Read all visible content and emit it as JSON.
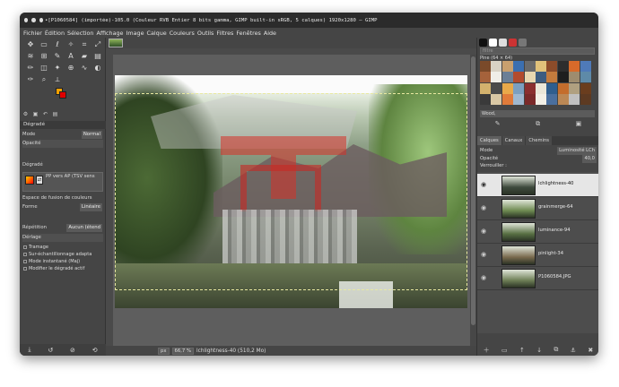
{
  "window": {
    "title": "•[P1060584] (importée)-105.0 (Couleur RVB Entier 8 bits gamma, GIMP built-in sRGB, 5 calques) 1920x1280 – GIMP"
  },
  "menu": [
    "Fichier",
    "Édition",
    "Sélection",
    "Affichage",
    "Image",
    "Calque",
    "Couleurs",
    "Outils",
    "Filtres",
    "Fenêtres",
    "Aide"
  ],
  "toolbox": {
    "tool_icons": [
      "move-icon",
      "rect-select-icon",
      "lasso-icon",
      "fuzzy-select-icon",
      "crop-icon",
      "unified-transform-icon",
      "warp-icon",
      "cage-icon",
      "paths-icon",
      "text-icon",
      "bucket-icon",
      "gradient-icon",
      "paintbrush-icon",
      "eraser-icon",
      "airbrush-icon",
      "clone-icon",
      "smudge-icon",
      "dodge-icon",
      "color-picker-icon",
      "zoom-icon",
      "measure-icon"
    ],
    "tool_glyphs": [
      "✥",
      "▭",
      "ℓ",
      "✧",
      "⌗",
      "⤢",
      "≋",
      "⊞",
      "✎",
      "A",
      "▰",
      "▤",
      "✏",
      "◫",
      "✦",
      "⊕",
      "∿",
      "◐",
      "✑",
      "⌕",
      "⟂"
    ],
    "tool_options_title": "Dégradé",
    "mode_label": "Mode",
    "mode_value": "Normal",
    "opacity_label": "Opacité",
    "gradient_label": "Dégradé",
    "gradient_name": "PP vers AP (TSV sens",
    "blend_space_label": "Espace de fusion de couleurs",
    "shape_label": "Forme",
    "shape_value": "Linéaire",
    "repeat_label": "Répétition",
    "repeat_value": "Aucun (étend",
    "dither_label": "Dérlage",
    "adaptive_label": "Tramage",
    "supersample_label": "Sur-échantillonnage adapta",
    "instant_label": "Mode instantané (Maj)",
    "modify_label": "Modifier le dégradé actif"
  },
  "canvas": {
    "unit": "px",
    "zoom": "66,7 %",
    "layer_status": "lchlightness-40 (510,2 Mo)"
  },
  "dock": {
    "filter_placeholder": "filtre",
    "pattern_label": "Pine (64 × 64)",
    "pattern_name": "Wood,",
    "tabs": [
      "Calques",
      "Canaux",
      "Chemins"
    ],
    "mode_label": "Mode",
    "mode_value": "Luminosité LCh",
    "opacity_label": "Opacité",
    "opacity_value": "40,0",
    "lock_label": "Verrouiller :",
    "layers": [
      {
        "name": "lchlightness-40",
        "active": true,
        "thumb": "#3e4a3d"
      },
      {
        "name": "grainmerge-64",
        "active": false,
        "thumb": "#6f8b52"
      },
      {
        "name": "luminance-94",
        "active": false,
        "thumb": "#587043"
      },
      {
        "name": "pinlight-34",
        "active": false,
        "thumb": "#7a6a4e"
      },
      {
        "name": "P1060584.JPG",
        "active": false,
        "thumb": "#6e7f56"
      }
    ]
  },
  "colors": {
    "foreground": "#f4a200",
    "background": "#e00000",
    "selected_layer_bg": "#e6e6e6"
  }
}
